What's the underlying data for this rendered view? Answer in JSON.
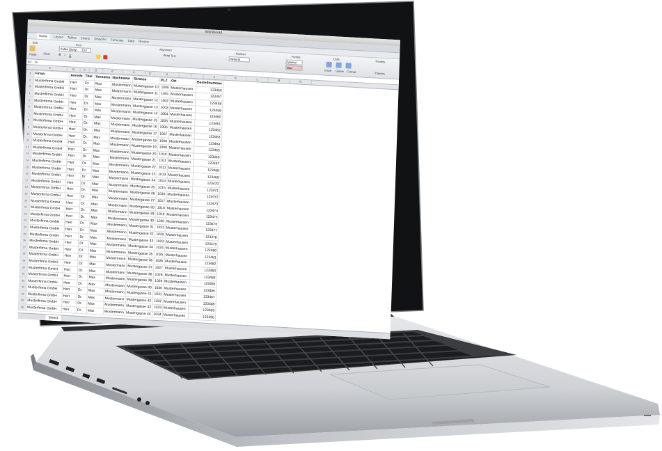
{
  "window": {
    "title": "Workbook1"
  },
  "ribbon": {
    "tabs": [
      "Home",
      "Layout",
      "Tables",
      "Charts",
      "SmartArt",
      "Formulas",
      "Data",
      "Review"
    ],
    "font_name": "Calibri (Body)",
    "font_size": "12",
    "paste_label": "Paste",
    "clear_label": "Clear",
    "wrap_label": "Wrap Text",
    "number_format": "General",
    "style_normal": "Normal",
    "style_bad": "Bad",
    "group_labels": [
      "Edit",
      "Font",
      "Alignment",
      "Number",
      "Format",
      "Cells",
      "Themes"
    ],
    "cells_buttons": [
      "Insert",
      "Delete",
      "Format",
      "Themes"
    ]
  },
  "formula_bar": {
    "cell_ref": "A1",
    "fx": "fx",
    "content": ""
  },
  "columns": [
    "A",
    "B",
    "C",
    "D",
    "E",
    "F",
    "G",
    "H",
    "I",
    "J",
    "K",
    "L",
    "M",
    "N"
  ],
  "table": {
    "headers": [
      "Firma",
      "Anrede",
      "Titel",
      "Vorname",
      "Nachname",
      "Strasse",
      "PLZ",
      "Ort",
      "Bestellnummer"
    ],
    "rows": [
      [
        "Musterfirma GmbH",
        "Herr",
        "Dr.",
        "Max",
        "Mustermann",
        "Mustergasse 10",
        "1000",
        "Musterhausen",
        "123456"
      ],
      [
        "Musterfirma GmbH",
        "Herr",
        "Dr.",
        "Max",
        "Mustermann",
        "Mustergasse 11",
        "1001",
        "Musterhausen",
        "123457"
      ],
      [
        "Musterfirma GmbH",
        "Herr",
        "Dr.",
        "Max",
        "Mustermann",
        "Mustergasse 12",
        "1002",
        "Musterhausen",
        "123458"
      ],
      [
        "Musterfirma GmbH",
        "Herr",
        "Dr.",
        "Max",
        "Mustermann",
        "Mustergasse 13",
        "1003",
        "Musterhausen",
        "123459"
      ],
      [
        "Musterfirma GmbH",
        "Herr",
        "Dr.",
        "Max",
        "Mustermann",
        "Mustergasse 14",
        "1004",
        "Musterhausen",
        "123460"
      ],
      [
        "Musterfirma GmbH",
        "Herr",
        "Dr.",
        "Max",
        "Mustermann",
        "Mustergasse 15",
        "1005",
        "Musterhausen",
        "123461"
      ],
      [
        "Musterfirma GmbH",
        "Herr",
        "Dr.",
        "Max",
        "Mustermann",
        "Mustergasse 16",
        "1006",
        "Musterhausen",
        "123462"
      ],
      [
        "Musterfirma GmbH",
        "Herr",
        "Dr.",
        "Max",
        "Mustermann",
        "Mustergasse 17",
        "1007",
        "Musterhausen",
        "123463"
      ],
      [
        "Musterfirma GmbH",
        "Herr",
        "Dr.",
        "Max",
        "Mustermann",
        "Mustergasse 18",
        "1008",
        "Musterhausen",
        "123464"
      ],
      [
        "Musterfirma GmbH",
        "Herr",
        "Dr.",
        "Max",
        "Mustermann",
        "Mustergasse 19",
        "1009",
        "Musterhausen",
        "123465"
      ],
      [
        "Musterfirma GmbH",
        "Herr",
        "Dr.",
        "Max",
        "Mustermann",
        "Mustergasse 20",
        "1010",
        "Musterhausen",
        "123466"
      ],
      [
        "Musterfirma GmbH",
        "Herr",
        "Dr.",
        "Max",
        "Mustermann",
        "Mustergasse 21",
        "1011",
        "Musterhausen",
        "123467"
      ],
      [
        "Musterfirma GmbH",
        "Herr",
        "Dr.",
        "Max",
        "Mustermann",
        "Mustergasse 22",
        "1012",
        "Musterhausen",
        "123468"
      ],
      [
        "Musterfirma GmbH",
        "Herr",
        "Dr.",
        "Max",
        "Mustermann",
        "Mustergasse 23",
        "1013",
        "Musterhausen",
        "123469"
      ],
      [
        "Musterfirma GmbH",
        "Herr",
        "Dr.",
        "Max",
        "Mustermann",
        "Mustergasse 24",
        "1014",
        "Musterhausen",
        "123470"
      ],
      [
        "Musterfirma GmbH",
        "Herr",
        "Dr.",
        "Max",
        "Mustermann",
        "Mustergasse 25",
        "1015",
        "Musterhausen",
        "123471"
      ],
      [
        "Musterfirma GmbH",
        "Herr",
        "Dr.",
        "Max",
        "Mustermann",
        "Mustergasse 26",
        "1016",
        "Musterhausen",
        "123472"
      ],
      [
        "Musterfirma GmbH",
        "Herr",
        "Dr.",
        "Max",
        "Mustermann",
        "Mustergasse 27",
        "1017",
        "Musterhausen",
        "123473"
      ],
      [
        "Musterfirma GmbH",
        "Herr",
        "Dr.",
        "Max",
        "Mustermann",
        "Mustergasse 28",
        "1018",
        "Musterhausen",
        "123474"
      ],
      [
        "Musterfirma GmbH",
        "Herr",
        "Dr.",
        "Max",
        "Mustermann",
        "Mustergasse 29",
        "1019",
        "Musterhausen",
        "123475"
      ],
      [
        "Musterfirma GmbH",
        "Herr",
        "Dr.",
        "Max",
        "Mustermann",
        "Mustergasse 30",
        "1020",
        "Musterhausen",
        "123476"
      ],
      [
        "Musterfirma GmbH",
        "Herr",
        "Dr.",
        "Max",
        "Mustermann",
        "Mustergasse 31",
        "1021",
        "Musterhausen",
        "123477"
      ],
      [
        "Musterfirma GmbH",
        "Herr",
        "Dr.",
        "Max",
        "Mustermann",
        "Mustergasse 32",
        "1022",
        "Musterhausen",
        "123478"
      ],
      [
        "Musterfirma GmbH",
        "Herr",
        "Dr.",
        "Max",
        "Mustermann",
        "Mustergasse 33",
        "1023",
        "Musterhausen",
        "123479"
      ],
      [
        "Musterfirma GmbH",
        "Herr",
        "Dr.",
        "Max",
        "Mustermann",
        "Mustergasse 34",
        "1024",
        "Musterhausen",
        "123480"
      ],
      [
        "Musterfirma GmbH",
        "Herr",
        "Dr.",
        "Max",
        "Mustermann",
        "Mustergasse 35",
        "1025",
        "Musterhausen",
        "123481"
      ],
      [
        "Musterfirma GmbH",
        "Herr",
        "Dr.",
        "Max",
        "Mustermann",
        "Mustergasse 36",
        "1026",
        "Musterhausen",
        "123482"
      ],
      [
        "Musterfirma GmbH",
        "Herr",
        "Dr.",
        "Max",
        "Mustermann",
        "Mustergasse 37",
        "1027",
        "Musterhausen",
        "123483"
      ],
      [
        "Musterfirma GmbH",
        "Herr",
        "Dr.",
        "Max",
        "Mustermann",
        "Mustergasse 38",
        "1028",
        "Musterhausen",
        "123484"
      ],
      [
        "Musterfirma GmbH",
        "Herr",
        "Dr.",
        "Max",
        "Mustermann",
        "Mustergasse 39",
        "1029",
        "Musterhausen",
        "123485"
      ],
      [
        "Musterfirma GmbH",
        "Herr",
        "Dr.",
        "Max",
        "Mustermann",
        "Mustergasse 40",
        "1030",
        "Musterhausen",
        "123486"
      ],
      [
        "Musterfirma GmbH",
        "Herr",
        "Dr.",
        "Max",
        "Mustermann",
        "Mustergasse 41",
        "1031",
        "Musterhausen",
        "123487"
      ],
      [
        "Musterfirma GmbH",
        "Herr",
        "Dr.",
        "Max",
        "Mustermann",
        "Mustergasse 42",
        "1032",
        "Musterhausen",
        "123488"
      ],
      [
        "Musterfirma GmbH",
        "Herr",
        "Dr.",
        "Max",
        "Mustermann",
        "Mustergasse 43",
        "1033",
        "Musterhausen",
        "123489"
      ],
      [
        "Musterfirma GmbH",
        "Herr",
        "Dr.",
        "Max",
        "Mustermann",
        "Mustergasse 44",
        "1034",
        "Musterhausen",
        "123490"
      ]
    ]
  },
  "sheet_tab": "Sheet1",
  "colors": {
    "aluminum": "#d3d6da",
    "bezel": "#111214",
    "key": "#1b1c1e",
    "excel_ribbon": "#e7eaee",
    "grid_line": "#d9dbdf"
  }
}
